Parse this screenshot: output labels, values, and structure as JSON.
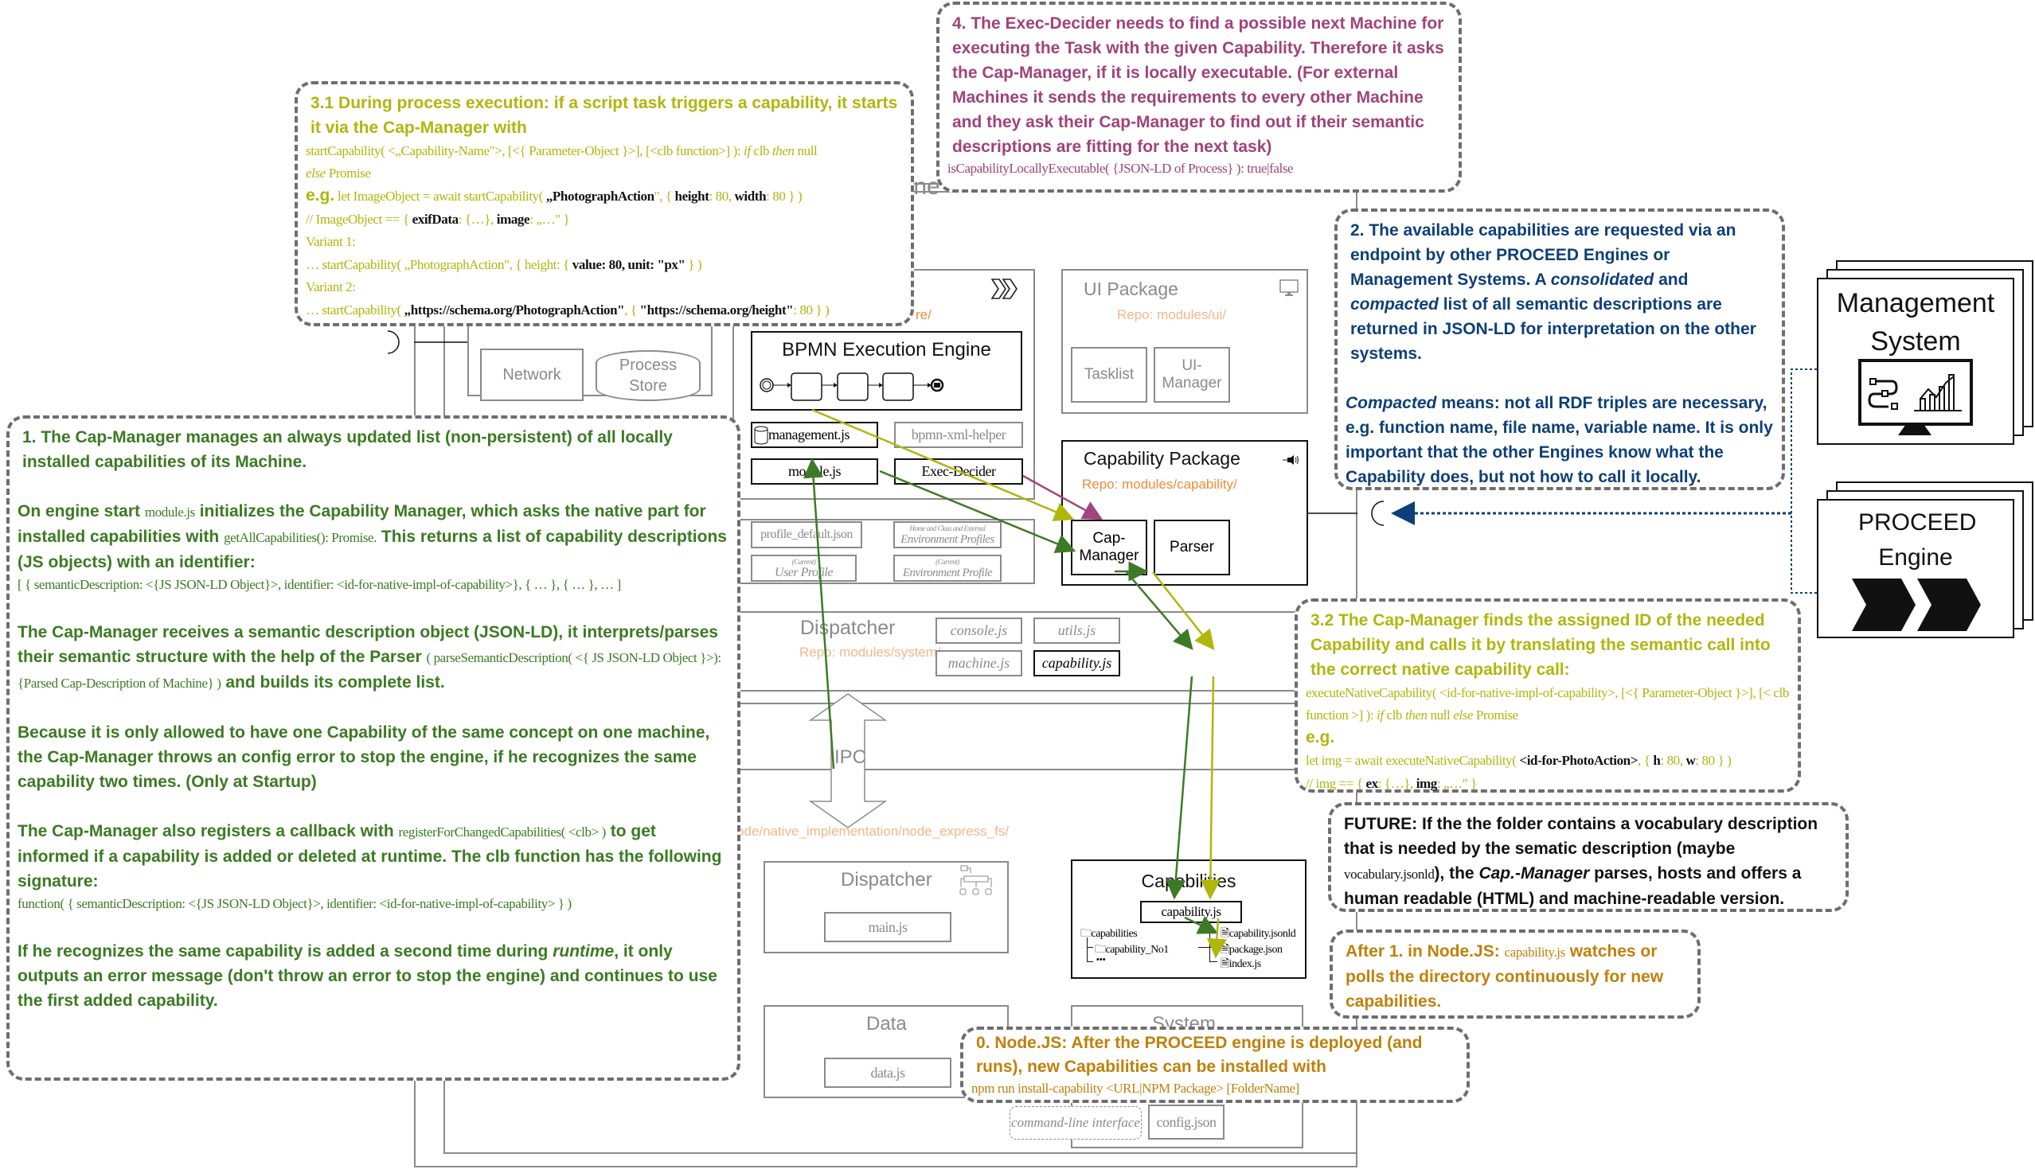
{
  "engine": {
    "title_fragment": "gine",
    "network": "Network",
    "process_store": "Process Store",
    "core": {
      "repo_fragment": "re/",
      "bpmn_engine": "BPMN Execution Engine",
      "management_js": "management.js",
      "bpmn_xml_helper": "bpmn-xml-helper",
      "module_js": "module.js",
      "exec_decider": "Exec-Decider"
    },
    "profiles": {
      "profile_default": "profile_default.json",
      "env_profiles_caption": "Home and Class and External",
      "env_profiles": "Environment Profiles",
      "user_profile_caption": "(Current)",
      "user_profile": "User Profile",
      "env_profile_caption": "(Current)",
      "env_profile": "Environment Profile"
    },
    "ui_package": {
      "title": "UI Package",
      "repo": "Repo: modules/ui/",
      "tasklist": "Tasklist",
      "ui_manager": "UI-Manager"
    },
    "capability_package": {
      "title": "Capability Package",
      "repo": "Repo: modules/capability/",
      "cap_manager": "Cap-Manager",
      "parser": "Parser"
    },
    "system_dispatcher": {
      "title": "Dispatcher",
      "repo": "Repo: modules/system/",
      "console_js": "console.js",
      "utils_js": "utils.js",
      "machine_js": "machine.js",
      "capability_js": "capability.js"
    },
    "ipc": "IPC",
    "native_repo": "ode/native_implementation/node_express_fs/",
    "native_dispatcher": {
      "title": "Dispatcher",
      "main_js": "main.js"
    },
    "capabilities": {
      "title": "Capabilities",
      "capability_js": "capability.js",
      "tree": {
        "root": "capabilities",
        "child": "capability_No1",
        "more": "•••",
        "files": [
          "capability.jsonld",
          "package.json",
          "index.js"
        ]
      }
    },
    "data": {
      "title": "Data",
      "data_js": "data.js"
    },
    "system": {
      "title": "System",
      "cli": "command-line interface",
      "config_json": "config.json"
    }
  },
  "external": {
    "management_system": "Management System",
    "proceed_engine": "PROCEED Engine"
  },
  "notes": {
    "n1": {
      "p1": "1. The Cap-Manager manages an always updated list (non-persistent) of all locally installed capabilities of its Machine.",
      "p2a": "On engine start ",
      "p2code1": "module.js",
      "p2b": " initializes the Capability  Manager, which asks the native part for installed capabilities with ",
      "p2code2": "getAllCapabilities(): Promise.",
      "p2c": " This returns a list of capability descriptions (JS objects) with an identifier:",
      "p2code3": "[ { semanticDescription: <{JS JSON-LD Object}>, identifier: <id-for-native-impl-of-capability>}, { … }, { … }, … ]",
      "p3a": "The Cap-Manager receives a semantic description object (JSON-LD), it interprets/parses their semantic structure with the help of the Parser ",
      "p3code": "( parseSemanticDescription( <{ JS JSON-LD Object }>): {Parsed Cap-Description of Machine} )",
      "p3b": " and builds its complete list.",
      "p4": "Because it is only allowed to have one Capability of the same concept on one machine, the Cap-Manager throws an config error to stop the engine, if he recognizes the same capability two times. (Only at Startup)",
      "p5a": "The Cap-Manager also registers a callback with ",
      "p5code": "registerForChangedCapabilities( <clb> )",
      "p5b": " to get informed if a capability is added or deleted at runtime. The clb function has the following signature:",
      "p5code2": "function( { semanticDescription: <{JS JSON-LD Object}>, identifier: <id-for-native-impl-of-capability> } )",
      "p6a": "If he recognizes the same capability is added a second time during ",
      "p6em": "runtime",
      "p6b": ", it only outputs an error message (don't throw an error to stop the engine) and continues to use the first added capability."
    },
    "n2": {
      "p1a": "2. The available capabilities are requested via an endpoint by other PROCEED Engines or Management Systems. A ",
      "p1em1": "consolidated",
      "p1b": " and ",
      "p1em2": "compacted",
      "p1c": " list of all semantic descriptions are returned in JSON-LD for interpretation on the other systems.",
      "p2em": "Compacted",
      "p2": " means: not all RDF triples are necessary, e.g. function name, file name, variable name. It is only important that the other Engines know what the Capability does, but not how to call it locally."
    },
    "n31": {
      "head": "3.1 During process execution: if a script task triggers a capability, it starts it via the Cap-Manager with",
      "sig": "startCapability( <„Capability-Name\">, [<{ Parameter-Object }>], [<clb function>] ): ",
      "sig_if": "if",
      "sig_clb": " clb ",
      "sig_then": "then",
      "sig_null": " null",
      "sig_else": "else",
      "sig_promise": " Promise",
      "eg": "e.g.",
      "eg_code_a": " let ImageObject = await startCapability( ",
      "eg_code_b": "„PhotographAction",
      "eg_code_c": "\", { ",
      "eg_code_d": "height",
      "eg_code_e": ": 80, ",
      "eg_code_f": "width",
      "eg_code_g": ": 80 } )",
      "comment_a": "// ImageObject == { ",
      "comment_b": "exifData",
      "comment_c": ": {…}, ",
      "comment_d": "image",
      "comment_e": ": „…\" }",
      "v1_label": "Variant 1:",
      "v1_a": "… startCapability( „PhotographAction\", { height: { ",
      "v1_b": "value: 80, unit: \"px\"",
      "v1_c": " } )",
      "v2_label": "Variant 2:",
      "v2_a": "… startCapability( ",
      "v2_b": "„https://schema.org/PhotographAction\"",
      "v2_c": ", { ",
      "v2_d": "\"https://schema.org/height\"",
      "v2_e": ": 80 } )"
    },
    "n32": {
      "head": "3.2 The Cap-Manager finds the assigned ID of the needed Capability and calls it by translating the semantic call into the correct native capability call:",
      "sig_a": "executeNativeCapability( <id-for-native-impl-of-capability>,  [<{ Parameter-Object }>], [< clb function >] ): ",
      "sig_if": "if",
      "sig_clb": " clb ",
      "sig_then": "then",
      "sig_null": " null ",
      "sig_else": "else",
      "sig_promise": " Promise",
      "eg": "e.g.",
      "eg_a": "let img = await executeNativeCapability( ",
      "eg_b": "<id-for-PhotoAction>",
      "eg_c": ",  { ",
      "eg_d": "h",
      "eg_e": ": 80, ",
      "eg_f": "w",
      "eg_g": ": 80 } )",
      "c_a": "// img == { ",
      "c_b": "ex",
      "c_c": ": {…}, ",
      "c_d": "img",
      "c_e": ": „…\" }"
    },
    "n4": {
      "text": "4. The Exec-Decider needs to find a possible next Machine for executing the Task with the given Capability. Therefore it asks the Cap-Manager, if it is locally executable. (For external Machines it sends the requirements to every other Machine and they ask their Cap-Manager to find out if their semantic descriptions are fitting for the next task)",
      "code": "isCapabilityLocallyExecutable( {JSON-LD of Process} ): true|false"
    },
    "future": {
      "a": "FUTURE: If the the folder contains a vocabulary description that is needed by the sematic description (maybe ",
      "code": "vocabulary.jsonld",
      "b": "), the ",
      "em": "Cap.-Manager",
      "c": " parses, hosts and offers a human readable (HTML) and machine-readable version."
    },
    "after1": {
      "a": "After 1. in Node.JS: ",
      "code": "capability.js",
      "b": " watches or polls the directory continuously for new capabilities."
    },
    "n0": {
      "text": "0. Node.JS: After the PROCEED engine is deployed (and runs), new Capabilities can be installed with",
      "code": "npm run install-capability <URL|NPM Package> [FolderName]"
    }
  },
  "colors": {
    "n1_green": "#3b7a22",
    "n2_blue": "#0d3f78",
    "n3_olive": "#b1b50c",
    "n4_magenta": "#a0427b",
    "n0_gold": "#c0800a",
    "repo_orange": "#f08a3a",
    "arrow_green": "#3d7a26",
    "arrow_olive": "#b0b60a",
    "arrow_magenta": "#a3447e",
    "arrow_blue": "#0d3f78"
  }
}
